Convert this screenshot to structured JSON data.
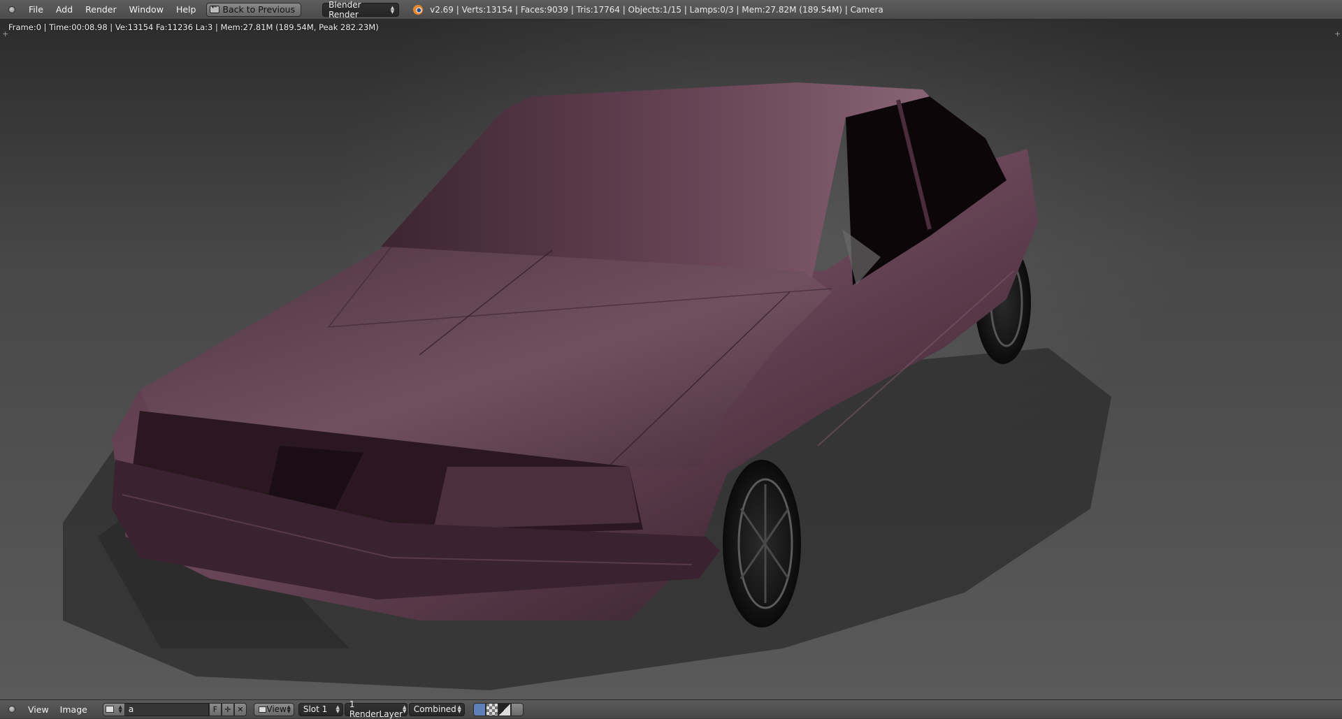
{
  "top_menu": {
    "items": [
      "File",
      "Add",
      "Render",
      "Window",
      "Help"
    ],
    "back_button": "Back to Previous",
    "render_engine": "Blender Render",
    "stats": "v2.69 | Verts:13154 | Faces:9039 | Tris:17764 | Objects:1/15 | Lamps:0/3 | Mem:27.82M (189.54M) | Camera"
  },
  "render": {
    "info": "Frame:0 | Time:00:08.98 | Ve:13154 Fa:11236 La:3 | Mem:27.81M (189.54M, Peak 282.23M)",
    "body_color": "#6e4a5c",
    "floor_color": "#5a5a5a"
  },
  "image_editor": {
    "view_menu": "View",
    "image_menu": "Image",
    "image_name": "a",
    "fake_user": "F",
    "view_select": "View",
    "slot_select": "Slot 1",
    "layer_select": "1 RenderLayer",
    "pass_select": "Combined"
  },
  "icons": {
    "area_toggle": "area-toggle-icon",
    "back": "back-arrow-icon",
    "logo": "blender-logo-icon",
    "image": "image-icon",
    "new": "plus-icon",
    "unlink": "x-icon"
  }
}
